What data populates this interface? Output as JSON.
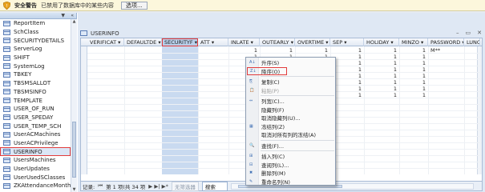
{
  "security_bar": {
    "title": "安全警告",
    "message": "已禁用了数据库中的某些内容",
    "button_label": "选项..."
  },
  "nav_pane": {
    "items": [
      {
        "label": "ReportItem",
        "selected": false
      },
      {
        "label": "SchClass",
        "selected": false
      },
      {
        "label": "SECURITYDETAILS",
        "selected": false
      },
      {
        "label": "ServerLog",
        "selected": false
      },
      {
        "label": "SHIFT",
        "selected": false
      },
      {
        "label": "SystemLog",
        "selected": false
      },
      {
        "label": "TBKEY",
        "selected": false
      },
      {
        "label": "TBSMSALLOT",
        "selected": false
      },
      {
        "label": "TBSMSINFO",
        "selected": false
      },
      {
        "label": "TEMPLATE",
        "selected": false
      },
      {
        "label": "USER_OF_RUN",
        "selected": false
      },
      {
        "label": "USER_SPEDAY",
        "selected": false
      },
      {
        "label": "USER_TEMP_SCH",
        "selected": false
      },
      {
        "label": "UserACMachines",
        "selected": false
      },
      {
        "label": "UserACPrivilege",
        "selected": false
      },
      {
        "label": "USERINFO",
        "selected": true
      },
      {
        "label": "UsersMachines",
        "selected": false
      },
      {
        "label": "UserUpdates",
        "selected": false
      },
      {
        "label": "UserUsedSClasses",
        "selected": false
      },
      {
        "label": "ZKAttendanceMonthSt...",
        "selected": false
      }
    ]
  },
  "document": {
    "tab_title": "USERINFO",
    "columns": [
      "VERIFICAT",
      "DEFAULTDE",
      "SECURITYF",
      "ATT",
      "INLATE",
      "OUTEARLY",
      "OVERTIME",
      "SEP",
      "HOLIDAY",
      "MINZO",
      "PASSWORD",
      "LUNCH"
    ],
    "selected_column": "SECURITYF",
    "cell_value": "1",
    "password_value": "M**"
  },
  "status_bar": {
    "record_label": "记录:",
    "first_btn": "⏮",
    "position_text": "第 1 项(共 34 项",
    "nav_buttons": "▶ ▶| ▶*",
    "filter_label": "无筛选器",
    "search_label": "搜索"
  },
  "context_menu": {
    "items": [
      {
        "label": "升序(S)",
        "disabled": false,
        "highlight": false
      },
      {
        "label": "降序(O)",
        "disabled": false,
        "highlight": true
      },
      {
        "label": "复制(C)",
        "disabled": false,
        "highlight": false
      },
      {
        "label": "粘贴(P)",
        "disabled": true,
        "highlight": false
      },
      {
        "label": "列宽(C)...",
        "disabled": false,
        "highlight": false
      },
      {
        "label": "隐藏列(F)",
        "disabled": false,
        "highlight": false
      },
      {
        "label": "取消隐藏列(U)...",
        "disabled": false,
        "highlight": false
      },
      {
        "label": "冻结列(Z)",
        "disabled": false,
        "highlight": false
      },
      {
        "label": "取消对所有列的冻结(A)",
        "disabled": false,
        "highlight": false
      },
      {
        "label": "查找(F)...",
        "disabled": false,
        "highlight": false
      },
      {
        "label": "插入列(C)",
        "disabled": false,
        "highlight": false
      },
      {
        "label": "查阅列(L)...",
        "disabled": false,
        "highlight": false
      },
      {
        "label": "删除列(M)",
        "disabled": false,
        "highlight": false
      },
      {
        "label": "重命名列(N)",
        "disabled": false,
        "highlight": false
      }
    ]
  },
  "colors": {
    "accent": "#e23c3c",
    "header_bg": "#e3eaf4",
    "selected_col": "#c9daf0"
  }
}
